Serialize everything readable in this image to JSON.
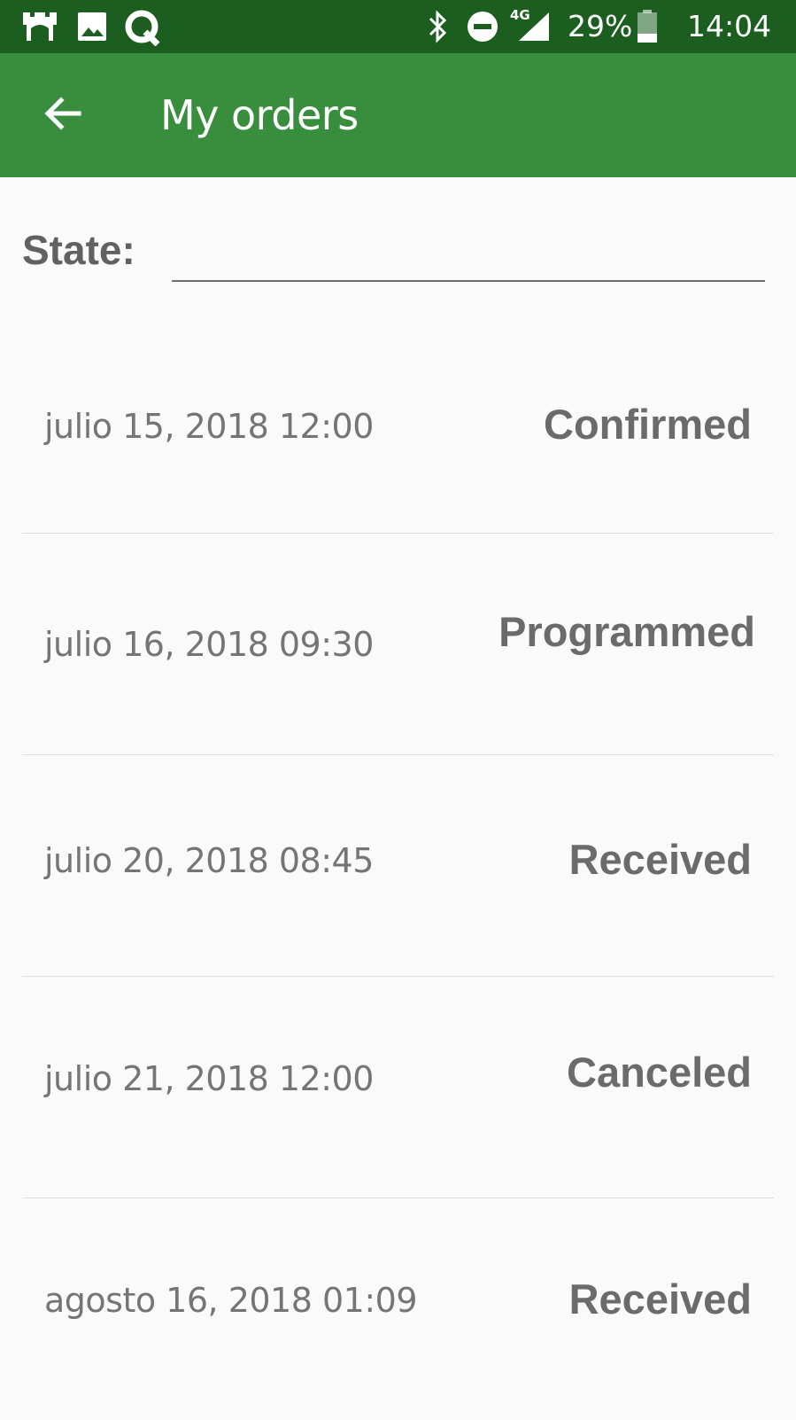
{
  "status_bar": {
    "icons_left": [
      "castle-icon",
      "image-icon",
      "q-app-icon"
    ],
    "icons_right": [
      "bluetooth-icon",
      "do-not-disturb-icon",
      "signal-4g-icon",
      "battery-icon"
    ],
    "network_label": "4G",
    "battery": "29%",
    "battery_level": 0.29,
    "time": "14:04"
  },
  "app_bar": {
    "title": "My orders",
    "back_icon": "arrow-back-icon",
    "color": "#388e3c",
    "status_color": "#1b5e20"
  },
  "filter": {
    "label": "State:",
    "value": ""
  },
  "orders": [
    {
      "date": "julio 15, 2018 12:00",
      "status": "Confirmed"
    },
    {
      "date": "julio 16, 2018 09:30",
      "status": "Programmed"
    },
    {
      "date": "julio 20, 2018 08:45",
      "status": "Received"
    },
    {
      "date": "julio 21, 2018 12:00",
      "status": "Canceled"
    },
    {
      "date": "agosto 16, 2018 01:09",
      "status": "Received"
    }
  ]
}
